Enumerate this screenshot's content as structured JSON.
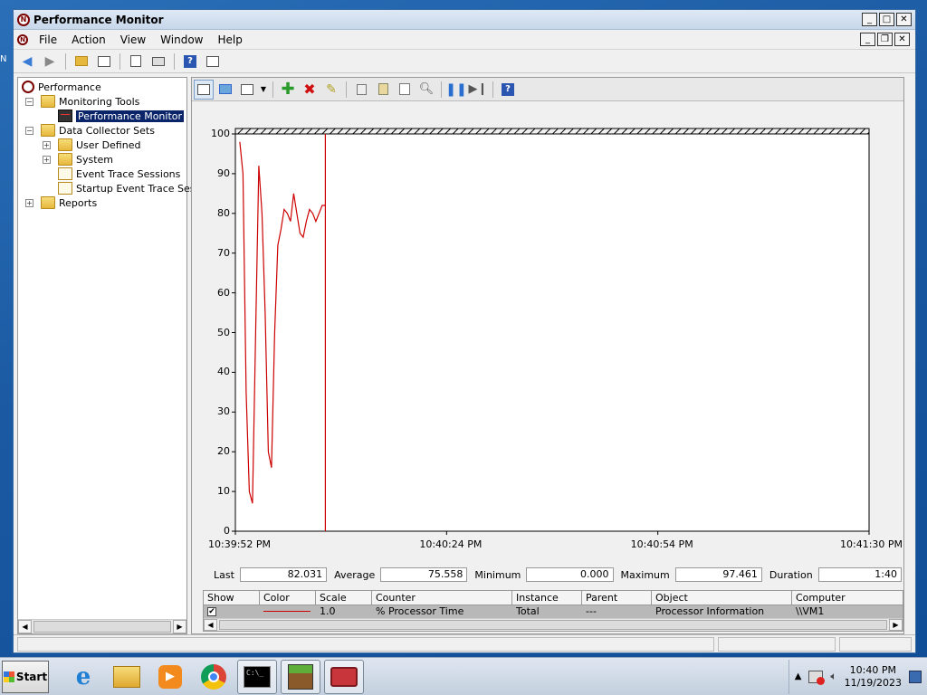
{
  "window": {
    "title": "Performance Monitor"
  },
  "desktop": {
    "sliver_text": "N"
  },
  "menu": [
    "File",
    "Action",
    "View",
    "Window",
    "Help"
  ],
  "tree": {
    "root": "Performance",
    "monitoring_tools": "Monitoring Tools",
    "performance_monitor": "Performance Monitor",
    "data_collector_sets": "Data Collector Sets",
    "user_defined": "User Defined",
    "system": "System",
    "event_trace_sessions": "Event Trace Sessions",
    "startup_event_trace": "Startup Event Trace Sess",
    "reports": "Reports"
  },
  "chart_data": {
    "type": "line",
    "ylim": [
      0,
      100
    ],
    "yticks": [
      "100",
      "90",
      "80",
      "70",
      "60",
      "50",
      "40",
      "30",
      "20",
      "10",
      "0"
    ],
    "xticks": [
      "10:39:52 PM",
      "10:40:24 PM",
      "10:40:54 PM",
      "10:41:30 PM"
    ],
    "series": [
      {
        "color": "#cc0000",
        "x": [
          0.7,
          1.2,
          1.7,
          2.2,
          2.7,
          3.2,
          3.7,
          4.2,
          4.7,
          5.2,
          5.7,
          6.2,
          6.7,
          7.2,
          7.7,
          8.2,
          8.7,
          9.2,
          9.7,
          10.2,
          10.7,
          11.2,
          11.7,
          12.2,
          12.7,
          13.2,
          13.7,
          14.2
        ],
        "values": [
          98,
          90,
          35,
          10,
          7,
          50,
          92,
          80,
          55,
          20,
          16,
          50,
          72,
          76,
          81,
          80,
          78,
          85,
          80,
          75,
          74,
          78,
          81,
          80,
          78,
          80,
          82,
          82
        ]
      }
    ],
    "current_marker_x": 14.2
  },
  "stats": {
    "last_label": "Last",
    "last": "82.031",
    "average_label": "Average",
    "average": "75.558",
    "minimum_label": "Minimum",
    "minimum": "0.000",
    "maximum_label": "Maximum",
    "maximum": "97.461",
    "duration_label": "Duration",
    "duration": "1:40"
  },
  "legend": {
    "headers": [
      "Show",
      "Color",
      "Scale",
      "Counter",
      "Instance",
      "Parent",
      "Object",
      "Computer"
    ],
    "row": {
      "show": "✔",
      "color": "#cc0000",
      "scale": "1.0",
      "counter": "% Processor Time",
      "instance": "Total",
      "parent": "---",
      "object": "Processor Information",
      "computer": "\\\\VM1"
    }
  },
  "taskbar": {
    "start_label": "Start",
    "time": "10:40 PM",
    "date": "11/19/2023"
  }
}
